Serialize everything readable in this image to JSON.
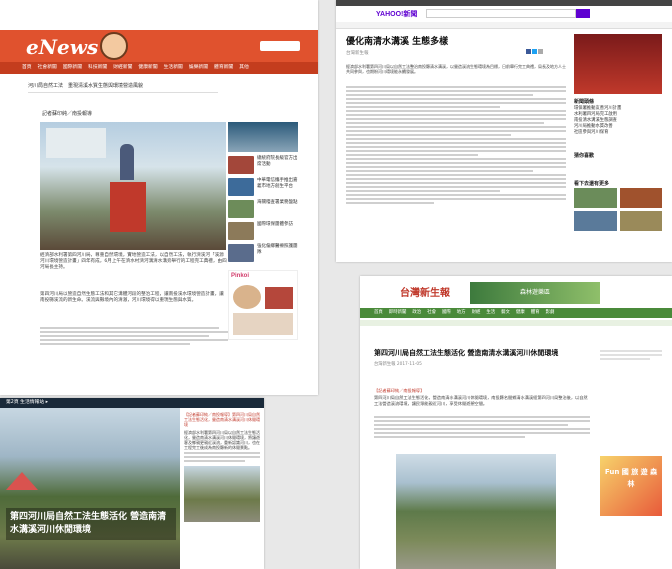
{
  "enews": {
    "logo": "eNews",
    "nav": [
      "首頁",
      "社會新聞",
      "國際新聞",
      "科技新聞",
      "財經新聞",
      "健康新聞",
      "生活新聞",
      "娛樂新聞",
      "體育新聞",
      "其他"
    ],
    "breadcrumb": "河川局自然工法　重現清溪水質生態與環境營造風貌",
    "reporter": "記者蘇印純／南投報導",
    "paragraph1": "經濟部水利署第四河川局，尊重自然環境，實地營造工法，以自然工法，執行濟溪河「溪源河川環境營造計畫」四年有成，6月上午在濟水村濟河溝清水溝旁舉行的工程完工典禮，由四河局長主持。",
    "paragraph2": "第四河川局以營造自然生態工法和其它溝體河段的整治工程，讓南投溪水環境營造計畫，讓南投縣溪流的新生命。溪流與縣境內的清澈，河川環境得以重現生態與水質。",
    "sidebar": [
      "總統府院長級官方出席活動",
      "中華電信攜手推出嘉義市地方創生平台",
      "海關稽查署業務盤點",
      "國際環保團體參訪",
      "強化偏鄉醫療照護團隊"
    ],
    "pinkoi": "Pinkoi"
  },
  "yahoo": {
    "logo": "YAHOO!新聞",
    "title": "優化南清水溝溪 生態多樣",
    "source": "台灣新生報",
    "right_heading1": "新聞頭條",
    "right_list": [
      "環保署推動友善河川計畫",
      "水利署四河局完工啟用",
      "南投清水溝溪生態調查",
      "河川局推動水質改善",
      "社區參與河川保育"
    ],
    "right_heading2": "猜你喜歡",
    "right_heading3": "看下去還有更多",
    "body": "經濟部水利署第四河川局以自然工法整治南投縣清水溝溪，以營造溪流生態環境為目標，日前舉行完工典禮，局長及地方人士共同參與，也期盼河川環境能永續發展。"
  },
  "life": {
    "topbar": "第2頁 生活情報站 ▸",
    "headline": "第四河川局自然工法生態活化 營造南清水溝溪河川休閒環境",
    "caption": "【記者蘇印純／南投報導】第四河川局自然工法生態活化，營造南清水溝溪河川休閒環境",
    "body": "經濟部水利署第四河川局以自然工法生態活化，營造南清水溝溪河川休閒環境，將讓遊客及鄉親更親近溪流，重新認識河川，也在工程完工後成為南投縣新的休閒景點。"
  },
  "taiwan": {
    "logo": "台灣新生報",
    "banner": "森林遊樂區",
    "nav": [
      "首頁",
      "即時新聞",
      "政治",
      "社會",
      "國際",
      "地方",
      "財經",
      "生活",
      "藝文",
      "健康",
      "體育",
      "影劇"
    ],
    "headline": "第四河川局自然工法生態活化 營造南清水溝溪河川休閒環境",
    "meta": "台灣新生報 2017-11-05",
    "lead": "【記者蘇印純／南投報導】",
    "body": "第四河川局自然工法生態活化，營造南清水溝溪河川休閒環境，南投縣名間鄉清水溝溪經第四河川局整治後，以自然工法營造溪流環境，讓民眾能親近河川，享受休閒遊憩空間。",
    "ad": "Fun 國 旅 遊 森 林"
  }
}
